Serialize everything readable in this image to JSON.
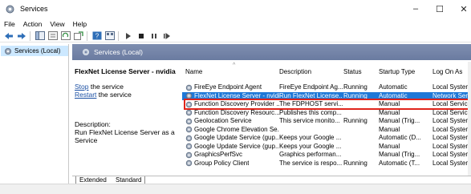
{
  "window": {
    "title": "Services",
    "min": "–",
    "max": "☐",
    "close": "✕"
  },
  "menu": [
    "File",
    "Action",
    "View",
    "Help"
  ],
  "toolbar": {
    "icons": [
      "back-arrow-icon",
      "forward-arrow-icon",
      "console-tree-icon",
      "properties-icon",
      "refresh-icon",
      "export-icon",
      "help-icon",
      "view-icon",
      "play-icon",
      "stop-icon",
      "pause-icon",
      "restart-icon"
    ]
  },
  "tree": {
    "root": "Services (Local)"
  },
  "header": {
    "title": "Services (Local)"
  },
  "detail": {
    "service_name": "FlexNet License Server - nvidia",
    "stop_link": "Stop",
    "stop_suffix": " the service",
    "restart_link": "Restart",
    "restart_suffix": " the service",
    "description_label": "Description:",
    "description_text": "Run FlexNet License Server as a Service"
  },
  "columns": {
    "name": "Name",
    "description": "Description",
    "status": "Status",
    "startup": "Startup Type",
    "logon": "Log On As",
    "sort_indicator": "^"
  },
  "rows": [
    {
      "name": "FireEye Endpoint Agent",
      "description": "FireEye Endpoint Ag...",
      "status": "Running",
      "startup": "Automatic",
      "logon": "Local System"
    },
    {
      "name": "FlexNet License Server - nvidia",
      "description": "Run FlexNet License...",
      "status": "Running",
      "startup": "Automatic",
      "logon": "Network Ser..."
    },
    {
      "name": "Function Discovery Provider ...",
      "description": "The FDPHOST servi...",
      "status": "",
      "startup": "Manual",
      "logon": "Local Service"
    },
    {
      "name": "Function Discovery Resourc...",
      "description": "Publishes this comp...",
      "status": "",
      "startup": "Manual",
      "logon": "Local Service"
    },
    {
      "name": "Geolocation Service",
      "description": "This service monito...",
      "status": "Running",
      "startup": "Manual (Trig...",
      "logon": "Local System"
    },
    {
      "name": "Google Chrome Elevation Se...",
      "description": "",
      "status": "",
      "startup": "Manual",
      "logon": "Local System"
    },
    {
      "name": "Google Update Service (gup...",
      "description": "Keeps your Google ...",
      "status": "",
      "startup": "Automatic (D...",
      "logon": "Local System"
    },
    {
      "name": "Google Update Service (gup...",
      "description": "Keeps your Google ...",
      "status": "",
      "startup": "Manual",
      "logon": "Local System"
    },
    {
      "name": "GraphicsPerfSvc",
      "description": "Graphics performan...",
      "status": "",
      "startup": "Manual (Trig...",
      "logon": "Local System"
    },
    {
      "name": "Group Policy Client",
      "description": "The service is respo...",
      "status": "Running",
      "startup": "Automatic (T...",
      "logon": "Local System"
    }
  ],
  "selected_row": 1,
  "tabs": [
    "Extended",
    "Standard"
  ],
  "colors": {
    "selection": "#1e78d7",
    "highlight_box": "#e0241b",
    "header_band": "#7384a8"
  }
}
